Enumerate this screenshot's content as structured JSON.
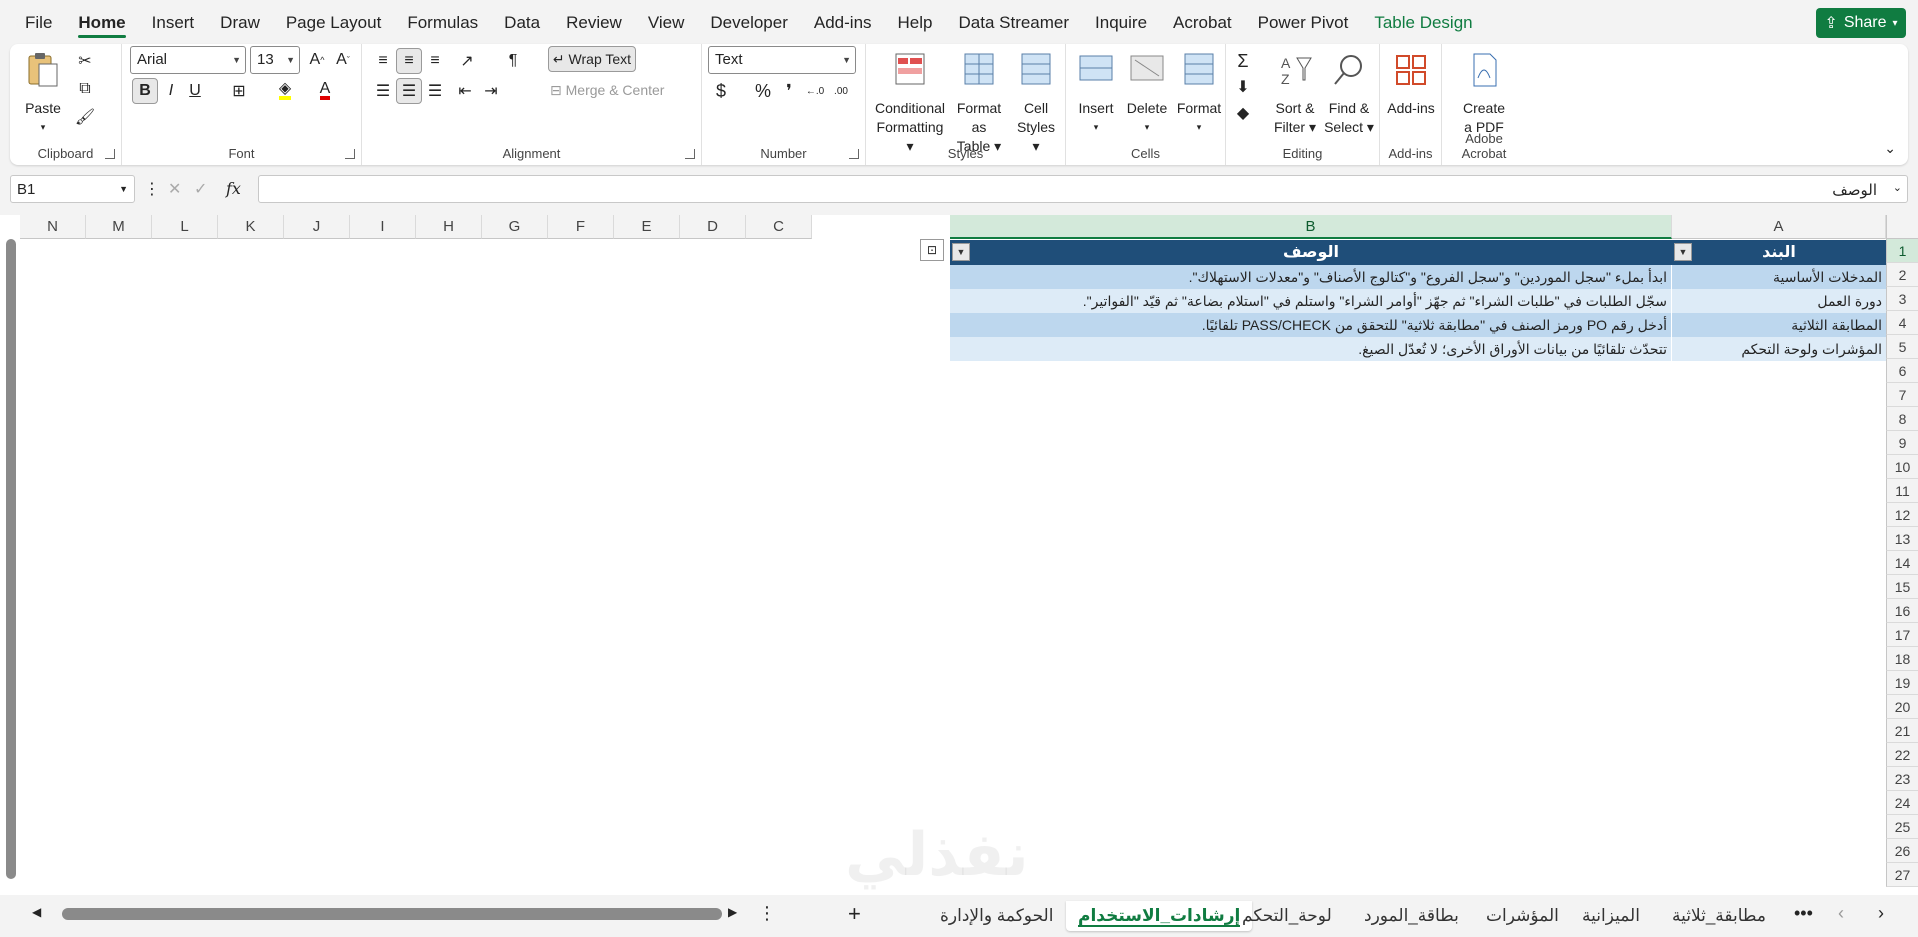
{
  "menu": {
    "tabs": [
      "File",
      "Home",
      "Insert",
      "Draw",
      "Page Layout",
      "Formulas",
      "Data",
      "Review",
      "View",
      "Developer",
      "Add-ins",
      "Help",
      "Data Streamer",
      "Inquire",
      "Acrobat",
      "Power Pivot",
      "Table Design"
    ],
    "share": "Share"
  },
  "ribbon": {
    "clipboard": {
      "paste": "Paste",
      "label": "Clipboard"
    },
    "font": {
      "name": "Arial",
      "size": "13",
      "bold": "B",
      "italic": "I",
      "underline": "U",
      "label": "Font"
    },
    "alignment": {
      "wrap": "Wrap Text",
      "merge": "Merge & Center",
      "label": "Alignment"
    },
    "number": {
      "format": "Text",
      "currency": "$",
      "percent": "%",
      "comma": "❜",
      "label": "Number"
    },
    "styles": {
      "conditional1": "Conditional",
      "conditional2": "Formatting",
      "formattable1": "Format as",
      "formattable2": "Table",
      "cellstyles1": "Cell",
      "cellstyles2": "Styles",
      "label": "Styles"
    },
    "cells": {
      "insert": "Insert",
      "delete": "Delete",
      "format": "Format",
      "label": "Cells"
    },
    "editing": {
      "sort1": "Sort &",
      "sort2": "Filter",
      "find1": "Find &",
      "find2": "Select",
      "label": "Editing"
    },
    "addins": {
      "btn": "Add-ins",
      "label": "Add-ins"
    },
    "acrobat": {
      "btn1": "Create",
      "btn2": "a PDF",
      "label": "Adobe Acrobat"
    }
  },
  "formula_bar": {
    "name_box": "B1",
    "fx": "fx",
    "content": "الوصف"
  },
  "columns": [
    "N",
    "M",
    "L",
    "K",
    "J",
    "I",
    "H",
    "G",
    "F",
    "E",
    "D",
    "C",
    "B",
    "A"
  ],
  "rows": [
    "1",
    "2",
    "3",
    "4",
    "5",
    "6",
    "7",
    "8",
    "9",
    "10",
    "11",
    "12",
    "13",
    "14",
    "15",
    "16",
    "17",
    "18",
    "19",
    "20",
    "21",
    "22",
    "23",
    "24",
    "25",
    "26",
    "27"
  ],
  "table": {
    "headers": {
      "a": "البند",
      "b": "الوصف"
    },
    "rows": [
      {
        "a": "المدخلات الأساسية",
        "b": "ابدأ بملء \"سجل الموردين\" و\"سجل الفروع\" و\"كتالوج الأصناف\" و\"معدلات الاستهلاك\"."
      },
      {
        "a": "دورة العمل",
        "b": "سجّل الطلبات في \"طلبات الشراء\" ثم جهّز \"أوامر الشراء\" واستلم في \"استلام بضاعة\" ثم قيّد \"الفواتير\"."
      },
      {
        "a": "المطابقة الثلاثية",
        "b": "أدخل رقم PO ورمز الصنف في \"مطابقة ثلاثية\" للتحقق من PASS/CHECK تلقائيًا."
      },
      {
        "a": "المؤشرات ولوحة التحكم",
        "b": "تتحدّث تلقائيًا من بيانات الأوراق الأخرى؛ لا تُعدّل الصيغ."
      }
    ]
  },
  "sheets": [
    "الحوكمة والإدارة",
    "إرشادات_الاستخدام",
    "لوحة_التحكم",
    "بطاقة_المورد",
    "المؤشرات",
    "الميزانية",
    "مطابقة_ثلاثية"
  ],
  "active_sheet_index": 1,
  "watermark": "نفذلي",
  "colors": {
    "accent": "#107c41",
    "table_header": "#1f4e79",
    "band1": "#bdd7ee",
    "band2": "#ddebf7"
  }
}
